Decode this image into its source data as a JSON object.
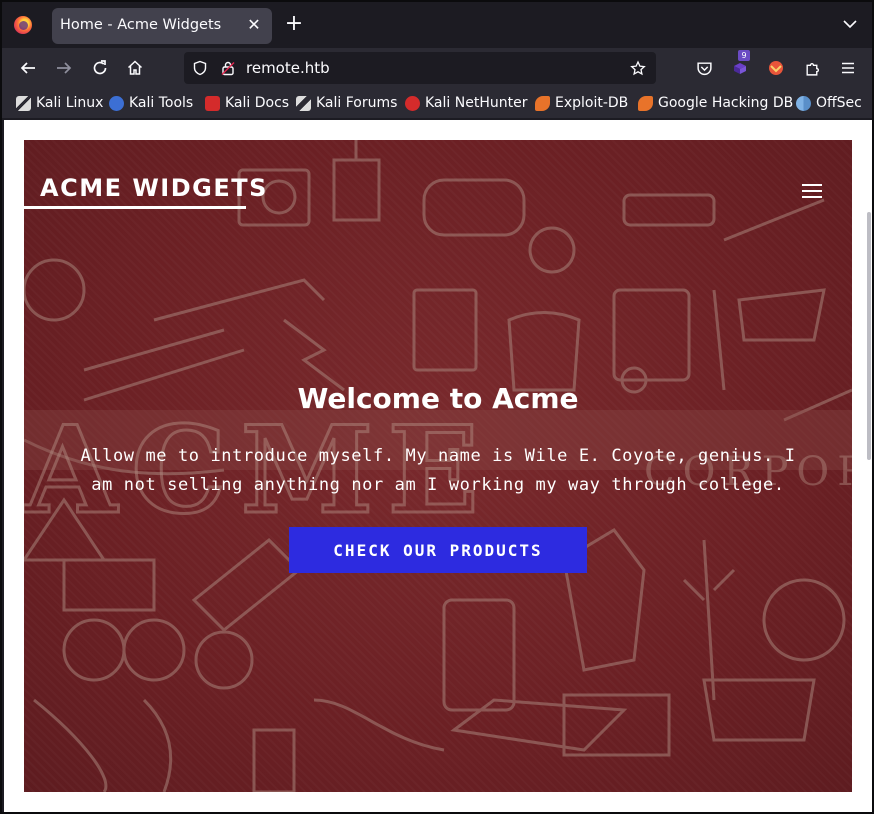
{
  "browser": {
    "tab_title": "Home - Acme Widgets",
    "url": "remote.htb",
    "extension_badge": "9"
  },
  "bookmarks": [
    {
      "label": "Kali Linux",
      "icon": "kali-dragon-icon",
      "color": "#e6e6e6"
    },
    {
      "label": "Kali Tools",
      "icon": "kali-tools-icon",
      "color": "#3c6fd4"
    },
    {
      "label": "Kali Docs",
      "icon": "kali-docs-icon",
      "color": "#d42b2b"
    },
    {
      "label": "Kali Forums",
      "icon": "kali-forums-icon",
      "color": "#e6e6e6"
    },
    {
      "label": "Kali NetHunter",
      "icon": "nethunter-icon",
      "color": "#d42b2b"
    },
    {
      "label": "Exploit-DB",
      "icon": "exploit-db-icon",
      "color": "#e8732a"
    },
    {
      "label": "Google Hacking DB",
      "icon": "ghdb-icon",
      "color": "#e8732a"
    },
    {
      "label": "OffSec",
      "icon": "offsec-icon",
      "color": "#7fb2e5"
    }
  ],
  "page": {
    "brand": "ACME WIDGETS",
    "heading": "Welcome to Acme",
    "intro_line1": "Allow me to introduce myself. My name is Wile E. Coyote, genius. I",
    "intro_line2": "am not selling anything nor am I working my way through college.",
    "cta_label": "CHECK OUR PRODUCTS"
  },
  "colors": {
    "hero_background": "#6f2226",
    "cta": "#2d2be0",
    "browser_chrome": "#2b2a33"
  }
}
